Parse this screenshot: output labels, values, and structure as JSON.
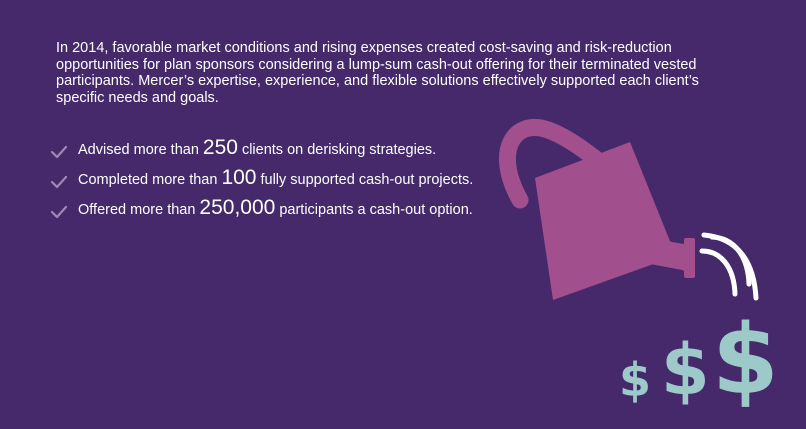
{
  "intro": {
    "text": "In 2014, favorable market conditions and rising expenses created cost-saving and risk-reduction opportunities for plan sponsors considering a lump-sum cash-out offering for their terminated vested participants. Mercer’s expertise, experience, and flexible solutions effectively supported each client’s specific needs and goals."
  },
  "bullets": [
    {
      "prefix": "Advised more than",
      "number": "250",
      "suffix": "clients on derisking strategies."
    },
    {
      "prefix": "Completed more than",
      "number": "100",
      "suffix": "fully supported cash-out projects."
    },
    {
      "prefix": "Offered more than",
      "number": "250,000",
      "suffix": "participants a cash-out option."
    }
  ],
  "illustration": {
    "dollar_signs": [
      "$",
      "$",
      "$"
    ],
    "can_color": "#a24f8e",
    "coin_color": "#9ec9c9",
    "check_color": "#9b8bb4"
  }
}
